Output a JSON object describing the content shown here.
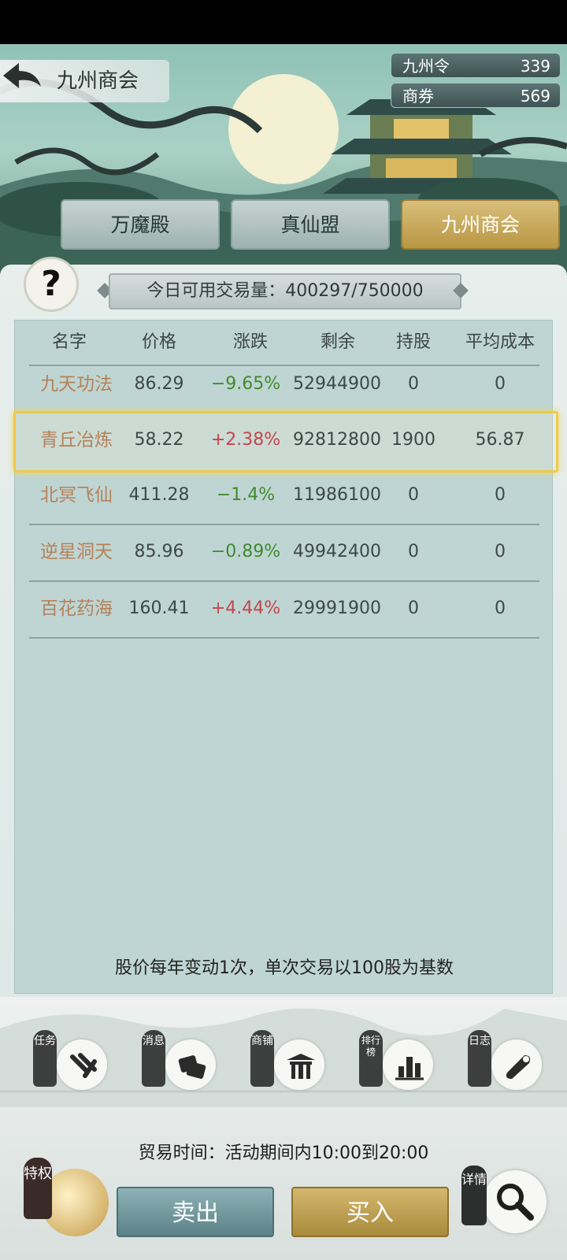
{
  "header": {
    "title": "九州商会",
    "currencies": [
      {
        "label": "九州令",
        "value": "339"
      },
      {
        "label": "商券",
        "value": "569"
      }
    ]
  },
  "tabs": [
    {
      "label": "万魔殿",
      "active": false
    },
    {
      "label": "真仙盟",
      "active": false
    },
    {
      "label": "九州商会",
      "active": true
    }
  ],
  "help_icon": "question-icon",
  "volume": {
    "text": "今日可用交易量：400297/750000"
  },
  "table": {
    "columns": [
      "名字",
      "价格",
      "涨跌",
      "剩余",
      "持股",
      "平均成本"
    ],
    "rows": [
      {
        "name": "九天功法",
        "price": "86.29",
        "change": "−9.65%",
        "trend": "down",
        "remaining": "52944900",
        "held": "0",
        "avg_cost": "0"
      },
      {
        "name": "青丘冶炼",
        "price": "58.22",
        "change": "+2.38%",
        "trend": "up",
        "remaining": "92812800",
        "held": "1900",
        "avg_cost": "56.87",
        "selected": true
      },
      {
        "name": "北冥飞仙",
        "price": "411.28",
        "change": "−1.4%",
        "trend": "down",
        "remaining": "11986100",
        "held": "0",
        "avg_cost": "0"
      },
      {
        "name": "逆星洞天",
        "price": "85.96",
        "change": "−0.89%",
        "trend": "down",
        "remaining": "49942400",
        "held": "0",
        "avg_cost": "0"
      },
      {
        "name": "百花药海",
        "price": "160.41",
        "change": "+4.44%",
        "trend": "up",
        "remaining": "29991900",
        "held": "0",
        "avg_cost": "0"
      }
    ]
  },
  "note": "股价每年变动1次，单次交易以100股为基数",
  "nav": [
    {
      "label": "任务",
      "icon": "scroll-brush-icon"
    },
    {
      "label": "消息",
      "icon": "letters-icon"
    },
    {
      "label": "商铺",
      "icon": "shop-gate-icon"
    },
    {
      "label": "排行榜",
      "icon": "ranking-bars-icon"
    },
    {
      "label": "日志",
      "icon": "scroll-icon"
    }
  ],
  "trade_time": "贸易时间：活动期间内10:00到20:00",
  "privilege_label": "特权",
  "buttons": {
    "sell": "卖出",
    "buy": "买入"
  },
  "detail_label": "详情",
  "colors": {
    "gold_accent": "#c9a755",
    "teal_button": "#6f9599",
    "up": "#c2474d",
    "down": "#3f8b2f",
    "name": "#b4825a"
  }
}
